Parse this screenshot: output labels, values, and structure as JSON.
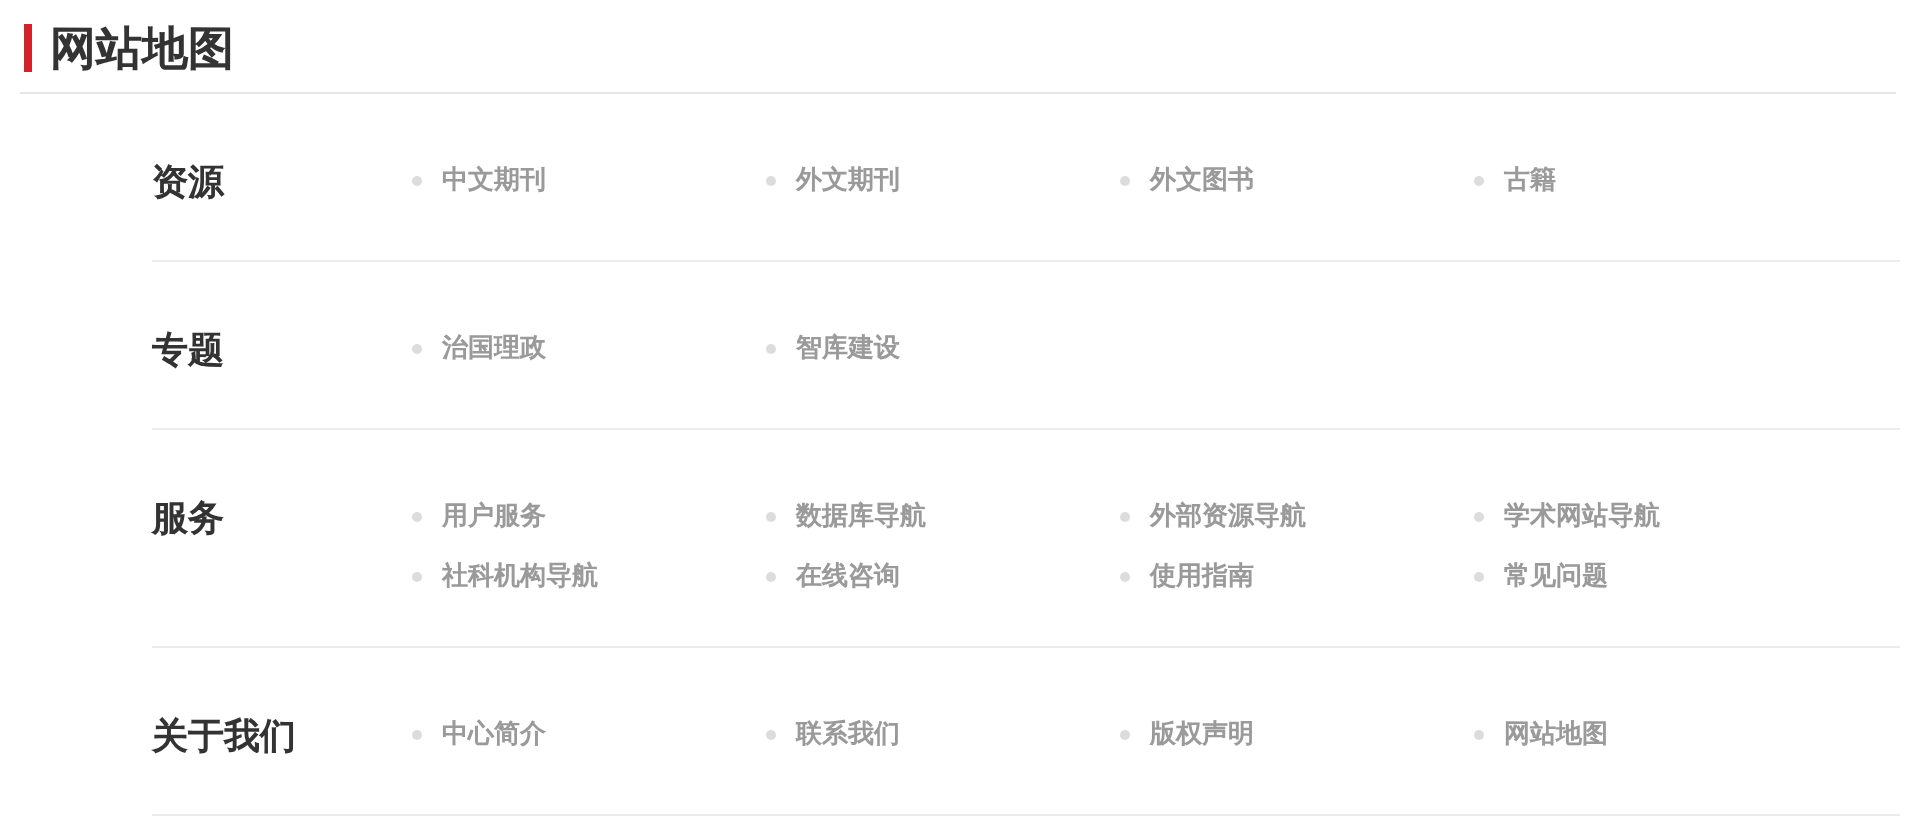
{
  "title": "网站地图",
  "sections": [
    {
      "heading": "资源",
      "links": [
        "中文期刊",
        "外文期刊",
        "外文图书",
        "古籍"
      ]
    },
    {
      "heading": "专题",
      "links": [
        "治国理政",
        "智库建设"
      ]
    },
    {
      "heading": "服务",
      "links": [
        "用户服务",
        "数据库导航",
        "外部资源导航",
        "学术网站导航",
        "社科机构导航",
        "在线咨询",
        "使用指南",
        "常见问题"
      ]
    },
    {
      "heading": "关于我们",
      "links": [
        "中心简介",
        "联系我们",
        "版权声明",
        "网站地图"
      ]
    }
  ]
}
